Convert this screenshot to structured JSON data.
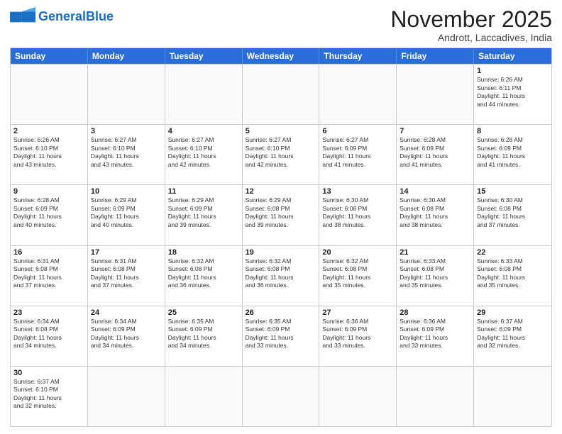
{
  "header": {
    "logo_general": "General",
    "logo_blue": "Blue",
    "month_title": "November 2025",
    "subtitle": "Andrott, Laccadives, India"
  },
  "days_of_week": [
    "Sunday",
    "Monday",
    "Tuesday",
    "Wednesday",
    "Thursday",
    "Friday",
    "Saturday"
  ],
  "weeks": [
    [
      {
        "day": "",
        "info": ""
      },
      {
        "day": "",
        "info": ""
      },
      {
        "day": "",
        "info": ""
      },
      {
        "day": "",
        "info": ""
      },
      {
        "day": "",
        "info": ""
      },
      {
        "day": "",
        "info": ""
      },
      {
        "day": "1",
        "info": "Sunrise: 6:26 AM\nSunset: 6:11 PM\nDaylight: 11 hours\nand 44 minutes."
      }
    ],
    [
      {
        "day": "2",
        "info": "Sunrise: 6:26 AM\nSunset: 6:10 PM\nDaylight: 11 hours\nand 43 minutes."
      },
      {
        "day": "3",
        "info": "Sunrise: 6:27 AM\nSunset: 6:10 PM\nDaylight: 11 hours\nand 43 minutes."
      },
      {
        "day": "4",
        "info": "Sunrise: 6:27 AM\nSunset: 6:10 PM\nDaylight: 11 hours\nand 42 minutes."
      },
      {
        "day": "5",
        "info": "Sunrise: 6:27 AM\nSunset: 6:10 PM\nDaylight: 11 hours\nand 42 minutes."
      },
      {
        "day": "6",
        "info": "Sunrise: 6:27 AM\nSunset: 6:09 PM\nDaylight: 11 hours\nand 41 minutes."
      },
      {
        "day": "7",
        "info": "Sunrise: 6:28 AM\nSunset: 6:09 PM\nDaylight: 11 hours\nand 41 minutes."
      },
      {
        "day": "8",
        "info": "Sunrise: 6:28 AM\nSunset: 6:09 PM\nDaylight: 11 hours\nand 41 minutes."
      }
    ],
    [
      {
        "day": "9",
        "info": "Sunrise: 6:28 AM\nSunset: 6:09 PM\nDaylight: 11 hours\nand 40 minutes."
      },
      {
        "day": "10",
        "info": "Sunrise: 6:29 AM\nSunset: 6:09 PM\nDaylight: 11 hours\nand 40 minutes."
      },
      {
        "day": "11",
        "info": "Sunrise: 6:29 AM\nSunset: 6:09 PM\nDaylight: 11 hours\nand 39 minutes."
      },
      {
        "day": "12",
        "info": "Sunrise: 6:29 AM\nSunset: 6:08 PM\nDaylight: 11 hours\nand 39 minutes."
      },
      {
        "day": "13",
        "info": "Sunrise: 6:30 AM\nSunset: 6:08 PM\nDaylight: 11 hours\nand 38 minutes."
      },
      {
        "day": "14",
        "info": "Sunrise: 6:30 AM\nSunset: 6:08 PM\nDaylight: 11 hours\nand 38 minutes."
      },
      {
        "day": "15",
        "info": "Sunrise: 6:30 AM\nSunset: 6:08 PM\nDaylight: 11 hours\nand 37 minutes."
      }
    ],
    [
      {
        "day": "16",
        "info": "Sunrise: 6:31 AM\nSunset: 6:08 PM\nDaylight: 11 hours\nand 37 minutes."
      },
      {
        "day": "17",
        "info": "Sunrise: 6:31 AM\nSunset: 6:08 PM\nDaylight: 11 hours\nand 37 minutes."
      },
      {
        "day": "18",
        "info": "Sunrise: 6:32 AM\nSunset: 6:08 PM\nDaylight: 11 hours\nand 36 minutes."
      },
      {
        "day": "19",
        "info": "Sunrise: 6:32 AM\nSunset: 6:08 PM\nDaylight: 11 hours\nand 36 minutes."
      },
      {
        "day": "20",
        "info": "Sunrise: 6:32 AM\nSunset: 6:08 PM\nDaylight: 11 hours\nand 35 minutes."
      },
      {
        "day": "21",
        "info": "Sunrise: 6:33 AM\nSunset: 6:08 PM\nDaylight: 11 hours\nand 35 minutes."
      },
      {
        "day": "22",
        "info": "Sunrise: 6:33 AM\nSunset: 6:08 PM\nDaylight: 11 hours\nand 35 minutes."
      }
    ],
    [
      {
        "day": "23",
        "info": "Sunrise: 6:34 AM\nSunset: 6:08 PM\nDaylight: 11 hours\nand 34 minutes."
      },
      {
        "day": "24",
        "info": "Sunrise: 6:34 AM\nSunset: 6:09 PM\nDaylight: 11 hours\nand 34 minutes."
      },
      {
        "day": "25",
        "info": "Sunrise: 6:35 AM\nSunset: 6:09 PM\nDaylight: 11 hours\nand 34 minutes."
      },
      {
        "day": "26",
        "info": "Sunrise: 6:35 AM\nSunset: 6:09 PM\nDaylight: 11 hours\nand 33 minutes."
      },
      {
        "day": "27",
        "info": "Sunrise: 6:36 AM\nSunset: 6:09 PM\nDaylight: 11 hours\nand 33 minutes."
      },
      {
        "day": "28",
        "info": "Sunrise: 6:36 AM\nSunset: 6:09 PM\nDaylight: 11 hours\nand 33 minutes."
      },
      {
        "day": "29",
        "info": "Sunrise: 6:37 AM\nSunset: 6:09 PM\nDaylight: 11 hours\nand 32 minutes."
      }
    ],
    [
      {
        "day": "30",
        "info": "Sunrise: 6:37 AM\nSunset: 6:10 PM\nDaylight: 11 hours\nand 32 minutes."
      },
      {
        "day": "",
        "info": ""
      },
      {
        "day": "",
        "info": ""
      },
      {
        "day": "",
        "info": ""
      },
      {
        "day": "",
        "info": ""
      },
      {
        "day": "",
        "info": ""
      },
      {
        "day": "",
        "info": ""
      }
    ]
  ]
}
